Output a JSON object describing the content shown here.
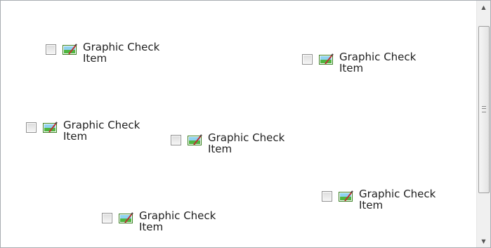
{
  "items": [
    {
      "label": "Graphic Check Item",
      "checked": false,
      "icon": "picture-edit-icon"
    },
    {
      "label": "Graphic Check Item",
      "checked": false,
      "icon": "picture-edit-icon"
    },
    {
      "label": "Graphic Check Item",
      "checked": false,
      "icon": "picture-edit-icon"
    },
    {
      "label": "Graphic Check Item",
      "checked": false,
      "icon": "picture-edit-icon"
    },
    {
      "label": "Graphic Check Item",
      "checked": false,
      "icon": "picture-edit-icon"
    },
    {
      "label": "Graphic Check Item",
      "checked": false,
      "icon": "picture-edit-icon"
    }
  ],
  "scrollbar": {
    "up_icon": "arrow-up-icon",
    "down_icon": "arrow-down-icon"
  }
}
